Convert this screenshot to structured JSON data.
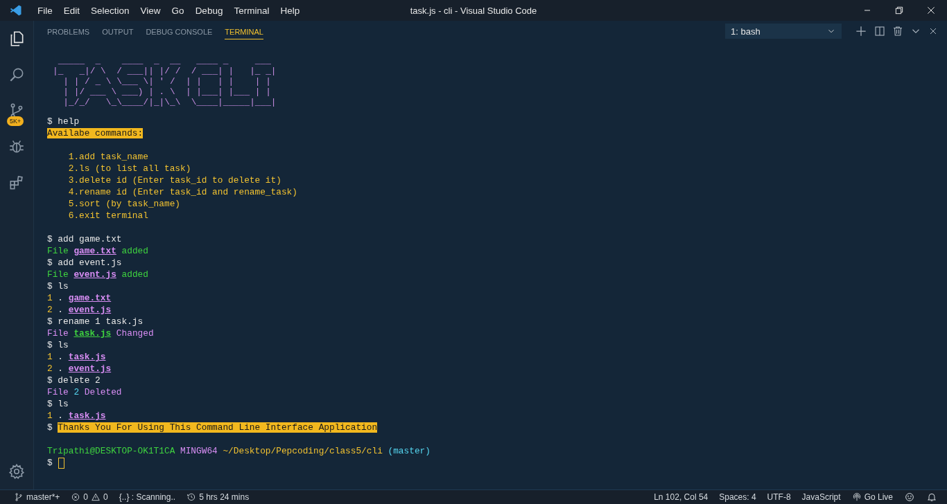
{
  "menu": [
    "File",
    "Edit",
    "Selection",
    "View",
    "Go",
    "Debug",
    "Terminal",
    "Help"
  ],
  "window": {
    "title": "task.js - cli - Visual Studio Code"
  },
  "activity_bar": {
    "badge": "5K+"
  },
  "panel": {
    "tabs": [
      {
        "label": "PROBLEMS",
        "selected": false
      },
      {
        "label": "OUTPUT",
        "selected": false
      },
      {
        "label": "DEBUG CONSOLE",
        "selected": false
      },
      {
        "label": "TERMINAL",
        "selected": true
      }
    ],
    "terminal_select": "1: bash"
  },
  "terminal": {
    "ascii_art": [
      " _____  _    ____  _  __   ____ _     ___ ",
      "|_   _|/ \\  / ___|| |/ /  / ___| |   |_ _|",
      "  | | / _ \\ \\___ \\| ' /  | |   | |    | | ",
      "  | |/ ___ \\ ___) | . \\  | |___| |___ | | ",
      "  |_/_/   \\_\\____/|_|\\_\\  \\____|_____|___|"
    ],
    "lines": [
      {
        "kind": "text",
        "segments": [
          {
            "text": "$ help",
            "kind": "plain"
          }
        ]
      },
      {
        "kind": "text",
        "segments": [
          {
            "text": "Availabe commands:",
            "kind": "highlight"
          }
        ]
      },
      {
        "kind": "blank"
      },
      {
        "kind": "text",
        "segments": [
          {
            "text": "    1.add task_name",
            "kind": "yellow"
          }
        ]
      },
      {
        "kind": "text",
        "segments": [
          {
            "text": "    2.ls (to list all task)",
            "kind": "yellow"
          }
        ]
      },
      {
        "kind": "text",
        "segments": [
          {
            "text": "    3.delete id (Enter task_id to delete it)",
            "kind": "yellow"
          }
        ]
      },
      {
        "kind": "text",
        "segments": [
          {
            "text": "    4.rename id (Enter task_id and rename_task)",
            "kind": "yellow"
          }
        ]
      },
      {
        "kind": "text",
        "segments": [
          {
            "text": "    5.sort (by task_name)",
            "kind": "yellow"
          }
        ]
      },
      {
        "kind": "text",
        "segments": [
          {
            "text": "    6.exit terminal",
            "kind": "yellow"
          }
        ]
      },
      {
        "kind": "blank"
      },
      {
        "kind": "text",
        "segments": [
          {
            "text": "$ add game.txt",
            "kind": "plain"
          }
        ]
      },
      {
        "kind": "text",
        "segments": [
          {
            "text": "File ",
            "kind": "green"
          },
          {
            "text": "game.txt",
            "kind": "link"
          },
          {
            "text": " added",
            "kind": "green"
          }
        ]
      },
      {
        "kind": "text",
        "segments": [
          {
            "text": "$ add event.js",
            "kind": "plain"
          }
        ]
      },
      {
        "kind": "text",
        "segments": [
          {
            "text": "File ",
            "kind": "green"
          },
          {
            "text": "event.js",
            "kind": "link"
          },
          {
            "text": " added",
            "kind": "green"
          }
        ]
      },
      {
        "kind": "text",
        "segments": [
          {
            "text": "$ ls",
            "kind": "plain"
          }
        ]
      },
      {
        "kind": "text",
        "segments": [
          {
            "text": "1",
            "kind": "yellow"
          },
          {
            "text": " . ",
            "kind": "plain"
          },
          {
            "text": "game.txt",
            "kind": "link"
          }
        ]
      },
      {
        "kind": "text",
        "segments": [
          {
            "text": "2",
            "kind": "yellow"
          },
          {
            "text": " . ",
            "kind": "plain"
          },
          {
            "text": "event.js",
            "kind": "link"
          }
        ]
      },
      {
        "kind": "text",
        "segments": [
          {
            "text": "$ rename 1 task.js",
            "kind": "plain"
          }
        ]
      },
      {
        "kind": "text",
        "segments": [
          {
            "text": "File ",
            "kind": "magenta"
          },
          {
            "text": "task.js",
            "kind": "green-link"
          },
          {
            "text": " Changed",
            "kind": "magenta"
          }
        ]
      },
      {
        "kind": "text",
        "segments": [
          {
            "text": "$ ls",
            "kind": "plain"
          }
        ]
      },
      {
        "kind": "text",
        "segments": [
          {
            "text": "1",
            "kind": "yellow"
          },
          {
            "text": " . ",
            "kind": "plain"
          },
          {
            "text": "task.js",
            "kind": "link"
          }
        ]
      },
      {
        "kind": "text",
        "segments": [
          {
            "text": "2",
            "kind": "yellow"
          },
          {
            "text": " . ",
            "kind": "plain"
          },
          {
            "text": "event.js",
            "kind": "link"
          }
        ]
      },
      {
        "kind": "text",
        "segments": [
          {
            "text": "$ delete 2",
            "kind": "plain"
          }
        ]
      },
      {
        "kind": "text",
        "segments": [
          {
            "text": "File ",
            "kind": "magenta"
          },
          {
            "text": "2",
            "kind": "cyan"
          },
          {
            "text": " Deleted",
            "kind": "magenta"
          }
        ]
      },
      {
        "kind": "text",
        "segments": [
          {
            "text": "$ ls",
            "kind": "plain"
          }
        ]
      },
      {
        "kind": "text",
        "segments": [
          {
            "text": "1",
            "kind": "yellow"
          },
          {
            "text": " . ",
            "kind": "plain"
          },
          {
            "text": "task.js",
            "kind": "link"
          }
        ]
      },
      {
        "kind": "text",
        "segments": [
          {
            "text": "$ ",
            "kind": "plain"
          },
          {
            "text": "Thanks You For Using This Command Line Interface Application",
            "kind": "highlight"
          }
        ]
      },
      {
        "kind": "blank"
      },
      {
        "kind": "text",
        "segments": [
          {
            "text": "Tripathi@DESKTOP-OK1T1CA ",
            "kind": "green"
          },
          {
            "text": "MINGW64 ",
            "kind": "magenta"
          },
          {
            "text": "~/Desktop/Pepcoding/class5/cli",
            "kind": "yellow"
          },
          {
            "text": " (master)",
            "kind": "cyan"
          }
        ]
      },
      {
        "kind": "input",
        "prompt": "$"
      }
    ]
  },
  "status_bar": {
    "branch": "master*+",
    "errors": "0",
    "warnings": "0",
    "scanning": "{..} : Scanning..",
    "timer": "5 hrs 24 mins",
    "position": "Ln 102, Col 54",
    "spaces": "Spaces: 4",
    "encoding": "UTF-8",
    "language": "JavaScript",
    "go_live": "Go Live"
  }
}
